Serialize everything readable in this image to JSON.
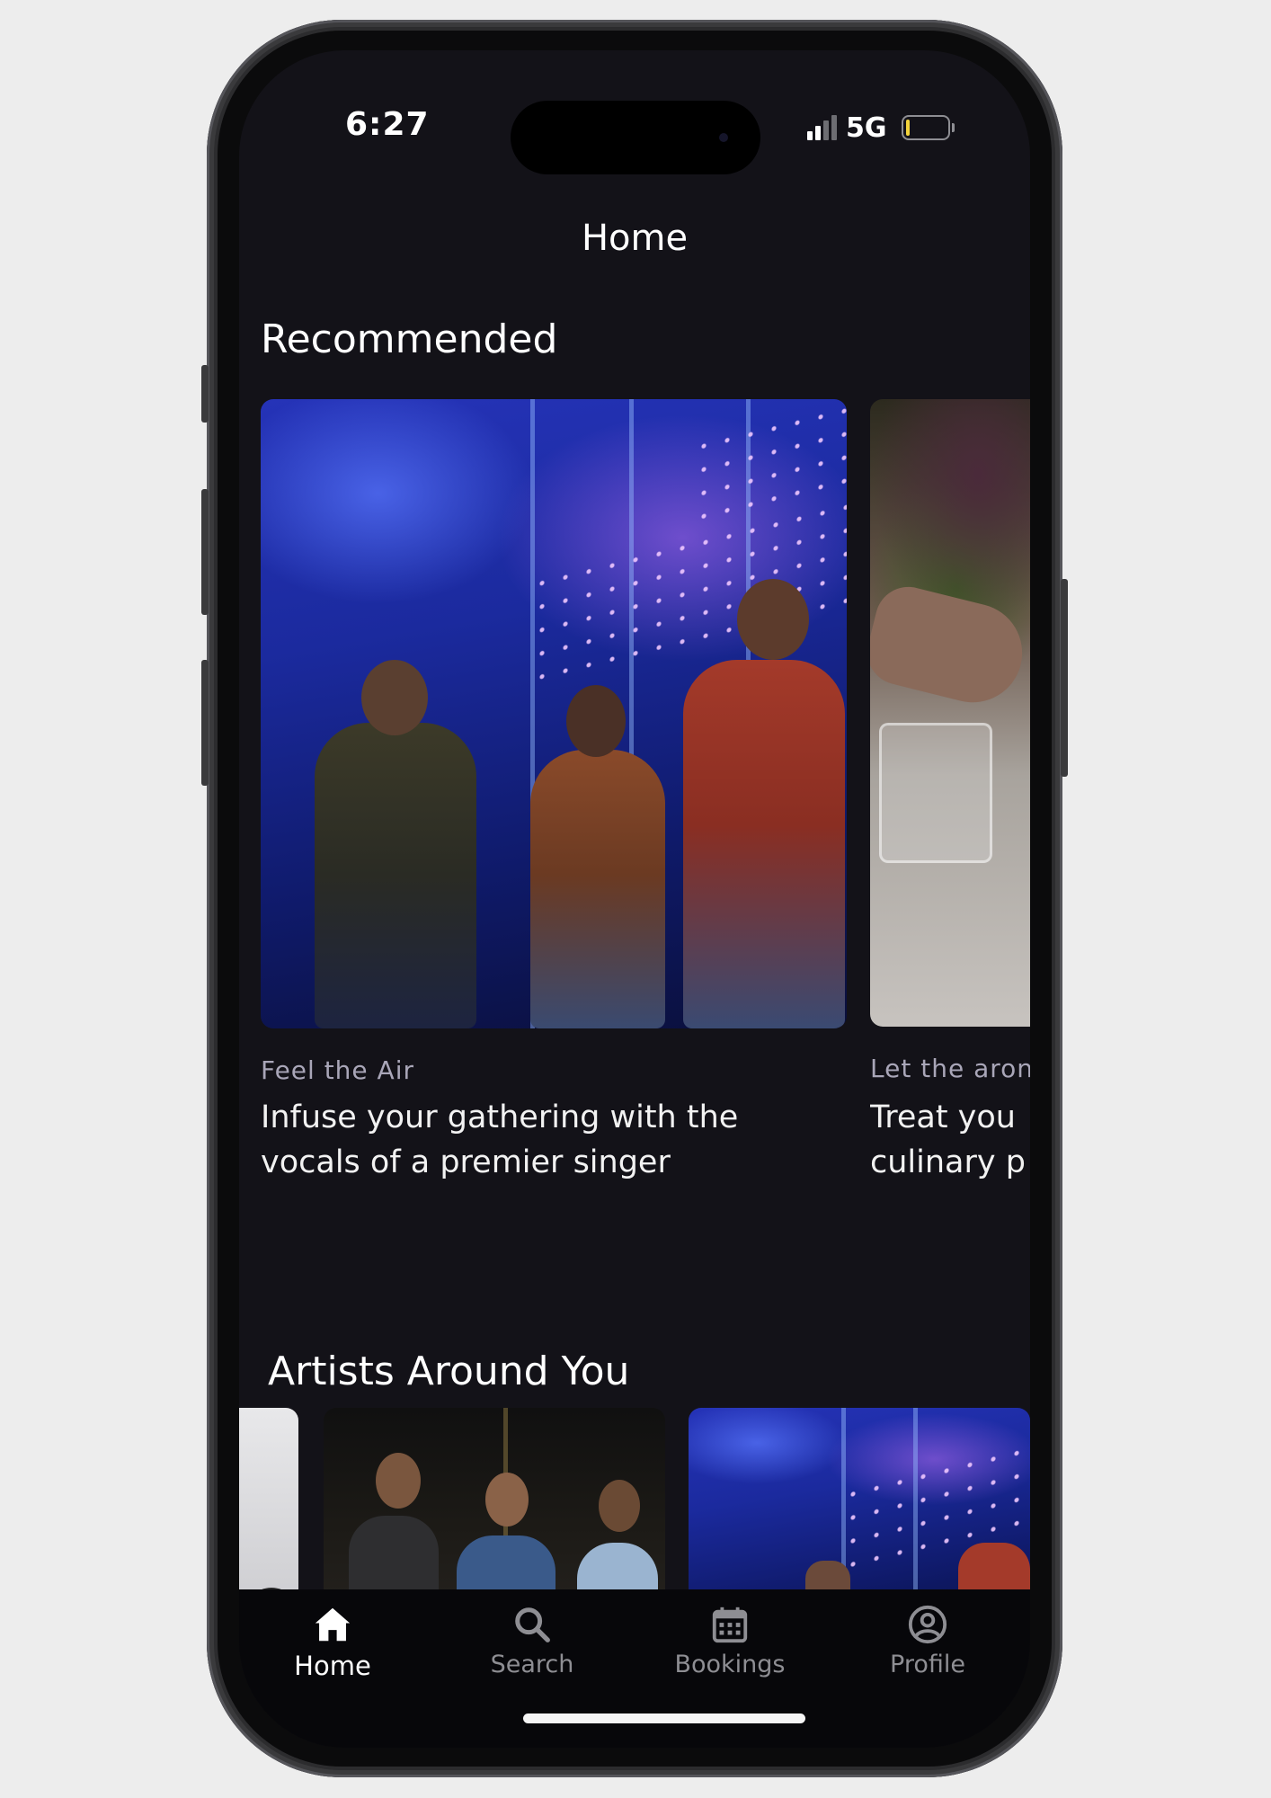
{
  "status_bar": {
    "time": "6:27",
    "network": "5G"
  },
  "nav": {
    "title": "Home"
  },
  "recommended": {
    "title": "Recommended",
    "cards": [
      {
        "eyebrow": "Feel the Air",
        "headline": "Infuse your gathering with the\nvocals of a premier singer"
      },
      {
        "eyebrow": "Let the aron",
        "headline": "Treat you\nculinary p"
      }
    ]
  },
  "artists": {
    "title": "Artists Around You"
  },
  "tabbar": {
    "items": [
      {
        "label": "Home",
        "icon": "home-icon"
      },
      {
        "label": "Search",
        "icon": "search-icon"
      },
      {
        "label": "Bookings",
        "icon": "calendar-icon"
      },
      {
        "label": "Profile",
        "icon": "profile-icon"
      }
    ]
  }
}
